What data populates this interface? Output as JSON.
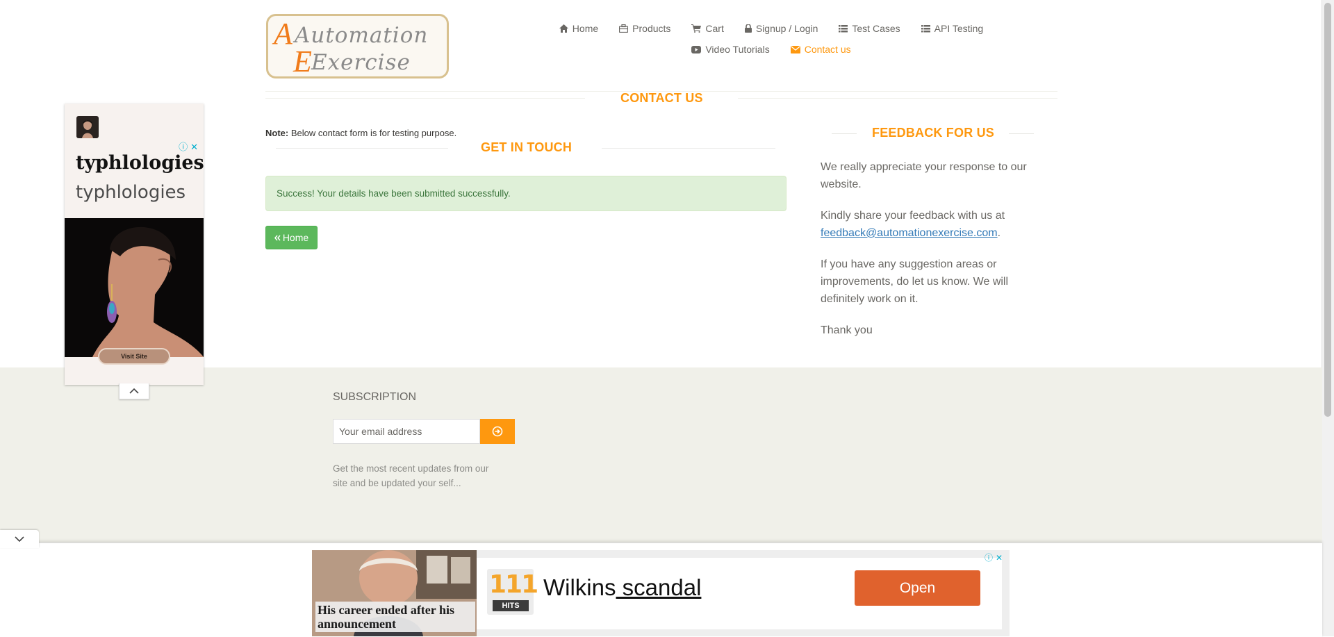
{
  "logo": {
    "line1": "Automation",
    "line2": "Exercise"
  },
  "nav": {
    "items": [
      {
        "label": "Home",
        "icon": "home-icon"
      },
      {
        "label": "Products",
        "icon": "briefcase-icon"
      },
      {
        "label": "Cart",
        "icon": "cart-icon"
      },
      {
        "label": "Signup / Login",
        "icon": "lock-icon"
      },
      {
        "label": "Test Cases",
        "icon": "list-icon"
      },
      {
        "label": "API Testing",
        "icon": "list-icon"
      },
      {
        "label": "Video Tutorials",
        "icon": "youtube-icon"
      },
      {
        "label": "Contact us",
        "icon": "envelope-icon",
        "active": true
      }
    ]
  },
  "contact": {
    "title": "CONTACT US",
    "note_label": "Note:",
    "note_text": " Below contact form is for testing purpose.",
    "get_in_touch": "GET IN TOUCH",
    "success": "Success! Your details have been submitted successfully.",
    "home_button": "Home"
  },
  "feedback": {
    "title": "FEEDBACK FOR US",
    "p1": "We really appreciate your response to our website.",
    "p2_prefix": "Kindly share your feedback with us at",
    "email": "feedback@automationexercise.com",
    "p2_suffix": ".",
    "p3": "If you have any suggestion areas or improvements, do let us know. We will definitely work on it.",
    "p4": "Thank you"
  },
  "footer": {
    "subscription_title": "SUBSCRIPTION",
    "email_placeholder": "Your email address",
    "description": "Get the most recent updates from our site and be updated your self..."
  },
  "side_ad": {
    "brand_bold": "typhlologies",
    "brand_light": "typhlologies",
    "visit_label": "Visit Site"
  },
  "bottom_ad": {
    "photo_caption": "His career ended after his announcement",
    "badge_number": "111",
    "badge_label": "HITS",
    "title_plain": "Wilkins",
    "title_underlined": " scandal ",
    "open_label": "Open"
  },
  "colors": {
    "accent": "#fe980f",
    "success_bg": "#dff0d8",
    "success_text": "#3c763d",
    "home_button": "#5cb85c",
    "footer_bg": "#f0f0e9",
    "link": "#337ab7",
    "ad_button": "#e0622d"
  }
}
